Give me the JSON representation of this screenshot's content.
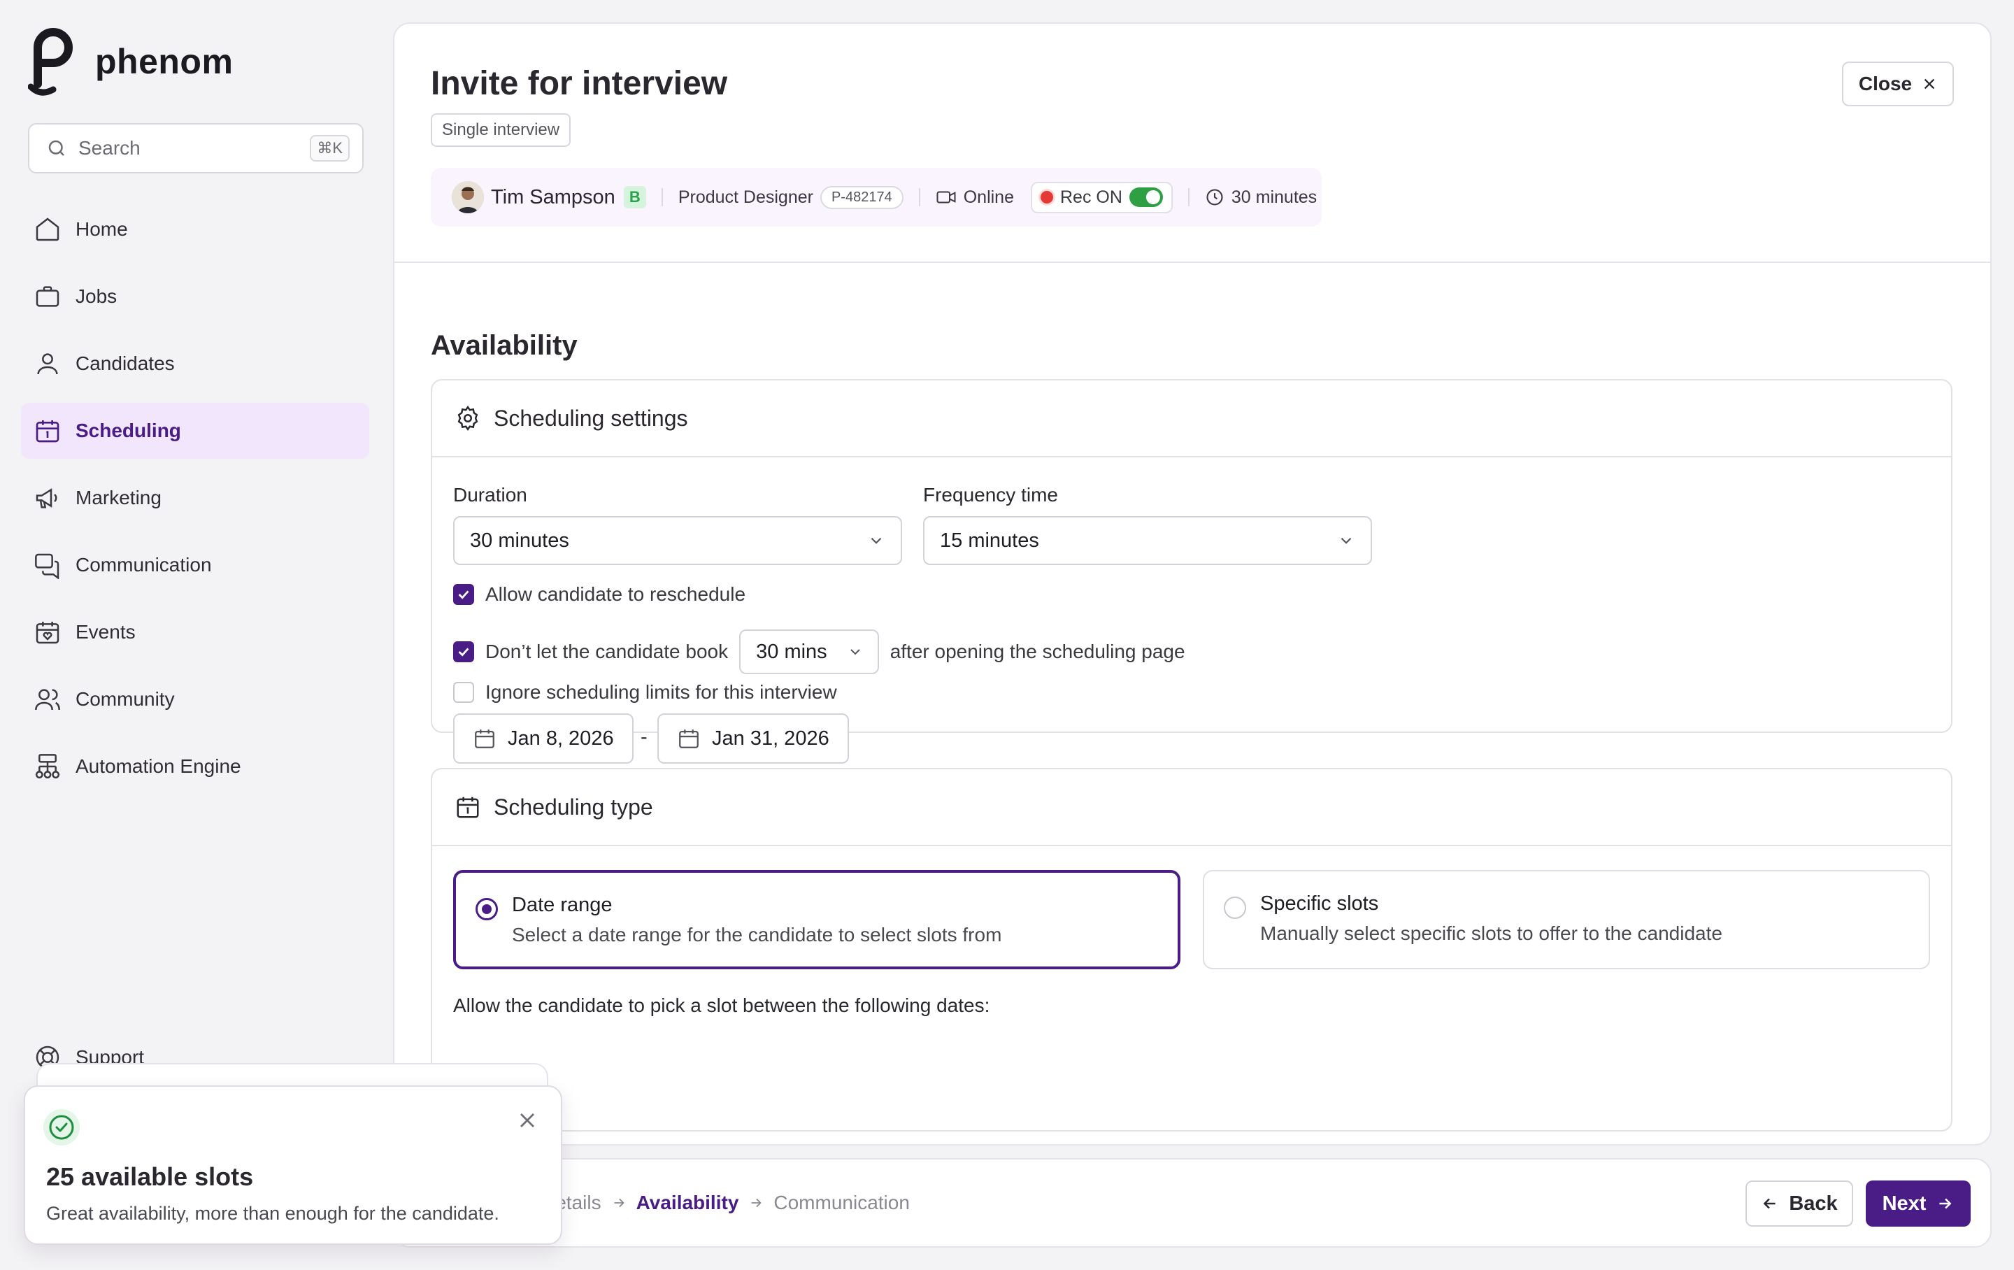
{
  "brand": {
    "name": "phenom",
    "color": "#4a1c86"
  },
  "search": {
    "placeholder": "Search",
    "shortcut": "⌘K"
  },
  "nav": {
    "items": [
      {
        "label": "Home",
        "icon": "home-icon"
      },
      {
        "label": "Jobs",
        "icon": "briefcase-icon"
      },
      {
        "label": "Candidates",
        "icon": "user-icon"
      },
      {
        "label": "Scheduling",
        "icon": "calendar-icon",
        "active": true
      },
      {
        "label": "Marketing",
        "icon": "megaphone-icon"
      },
      {
        "label": "Communication",
        "icon": "chat-icon"
      },
      {
        "label": "Events",
        "icon": "event-icon"
      },
      {
        "label": "Community",
        "icon": "users-icon"
      },
      {
        "label": "Automation Engine",
        "icon": "workflow-icon"
      }
    ],
    "support": "Support"
  },
  "header": {
    "title": "Invite for interview",
    "tag": "Single interview",
    "close_label": "Close"
  },
  "candidate": {
    "name": "Tim Sampson",
    "badge": "B",
    "role": "Product Designer",
    "req_id": "P-482174",
    "mode": "Online",
    "rec_label": "Rec ON",
    "duration": "30 minutes"
  },
  "availability": {
    "title": "Availability",
    "settings": {
      "title": "Scheduling settings",
      "duration_label": "Duration",
      "duration_value": "30 minutes",
      "frequency_label": "Frequency time",
      "frequency_value": "15 minutes",
      "allow_reschedule": "Allow candidate to reschedule",
      "no_book_prefix": "Don’t let the candidate book",
      "no_book_value": "30 mins",
      "no_book_suffix": "after opening the scheduling page",
      "ignore_limits": "Ignore scheduling limits for this interview"
    },
    "type": {
      "title": "Scheduling type",
      "date_range_title": "Date range",
      "date_range_desc": "Select a date range for the candidate to select slots from",
      "specific_title": "Specific slots",
      "specific_desc": "Manually select specific slots to offer to the candidate",
      "pick_label": "Allow the candidate to pick a slot between the following dates:",
      "start_date": "Jan 8, 2026",
      "separator": "-",
      "end_date": "Jan 31, 2026"
    }
  },
  "footer": {
    "steps": [
      "Details",
      "Availability",
      "Communication"
    ],
    "back_label": "Back",
    "next_label": "Next"
  },
  "toast": {
    "title": "25 available slots",
    "message": "Great availability, more than enough for the candidate."
  }
}
